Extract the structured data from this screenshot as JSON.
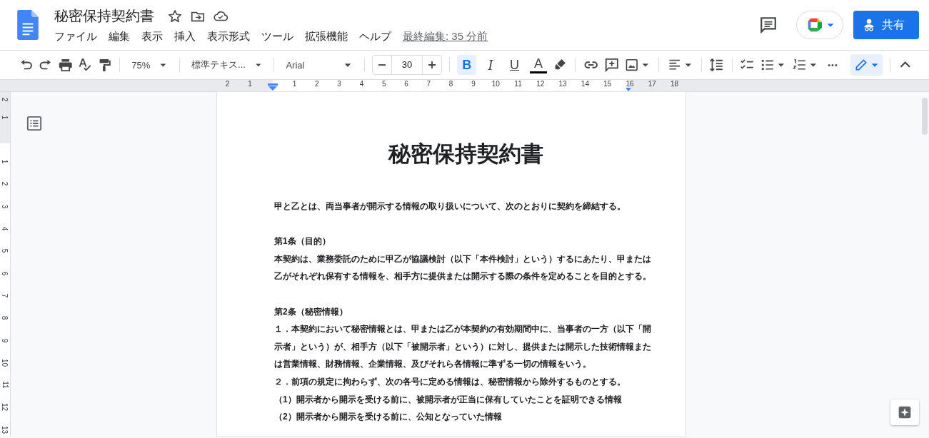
{
  "document": {
    "title": "秘密保持契約書"
  },
  "menu": [
    "ファイル",
    "編集",
    "表示",
    "挿入",
    "表示形式",
    "ツール",
    "拡張機能",
    "ヘルプ"
  ],
  "last_edit": "最終編集: 35 分前",
  "share_button": "共有",
  "toolbar": {
    "zoom": "75%",
    "style": "標準テキス...",
    "font": "Arial",
    "font_size": "30",
    "format_buttons": [
      {
        "kind": "bold",
        "label": "B",
        "selected": true
      },
      {
        "kind": "italic",
        "label": "I",
        "selected": false
      },
      {
        "kind": "underline",
        "label": "U",
        "selected": false
      }
    ],
    "text_color_label": "A",
    "more": "•••"
  },
  "ruler": {
    "left_numbers": [
      "2",
      "1"
    ],
    "right_numbers": [
      "1",
      "2",
      "3",
      "4",
      "5",
      "6",
      "7",
      "8",
      "9",
      "10",
      "11",
      "12",
      "13",
      "14",
      "15",
      "16",
      "17",
      "18"
    ]
  },
  "vertical_ruler": {
    "top_numbers": [
      "2",
      "1"
    ],
    "numbers": [
      "1",
      "2",
      "3",
      "4",
      "5",
      "6",
      "7",
      "8",
      "9",
      "10",
      "11",
      "12",
      "13"
    ]
  },
  "page": {
    "heading": "秘密保持契約書",
    "intro": "甲と乙とは、両当事者が開示する情報の取り扱いについて、次のとおりに契約を締結する。",
    "sections": [
      {
        "heading": "第1条（目的）",
        "paragraphs": [
          "本契約は、業務委託のために甲乙が協議検討（以下「本件検討」という）するにあたり、甲または乙がそれぞれ保有する情報を、相手方に提供または開示する際の条件を定めることを目的とする。"
        ]
      },
      {
        "heading": "第2条（秘密情報）",
        "paragraphs": [
          "１．本契約において秘密情報とは、甲または乙が本契約の有効期間中に、当事者の一方（以下「開示者」という）が、相手方（以下「被開示者」という）に対し、提供または開示した技術情報または営業情報、財務情報、企業情報、及びそれら各情報に準ずる一切の情報をいう。",
          "２．前項の規定に拘わらず、次の各号に定める情報は、秘密情報から除外するものとする。",
          "（1）開示者から開示を受ける前に、被開示者が正当に保有していたことを証明できる情報",
          "（2）開示者から開示を受ける前に、公知となっていた情報"
        ]
      }
    ]
  }
}
